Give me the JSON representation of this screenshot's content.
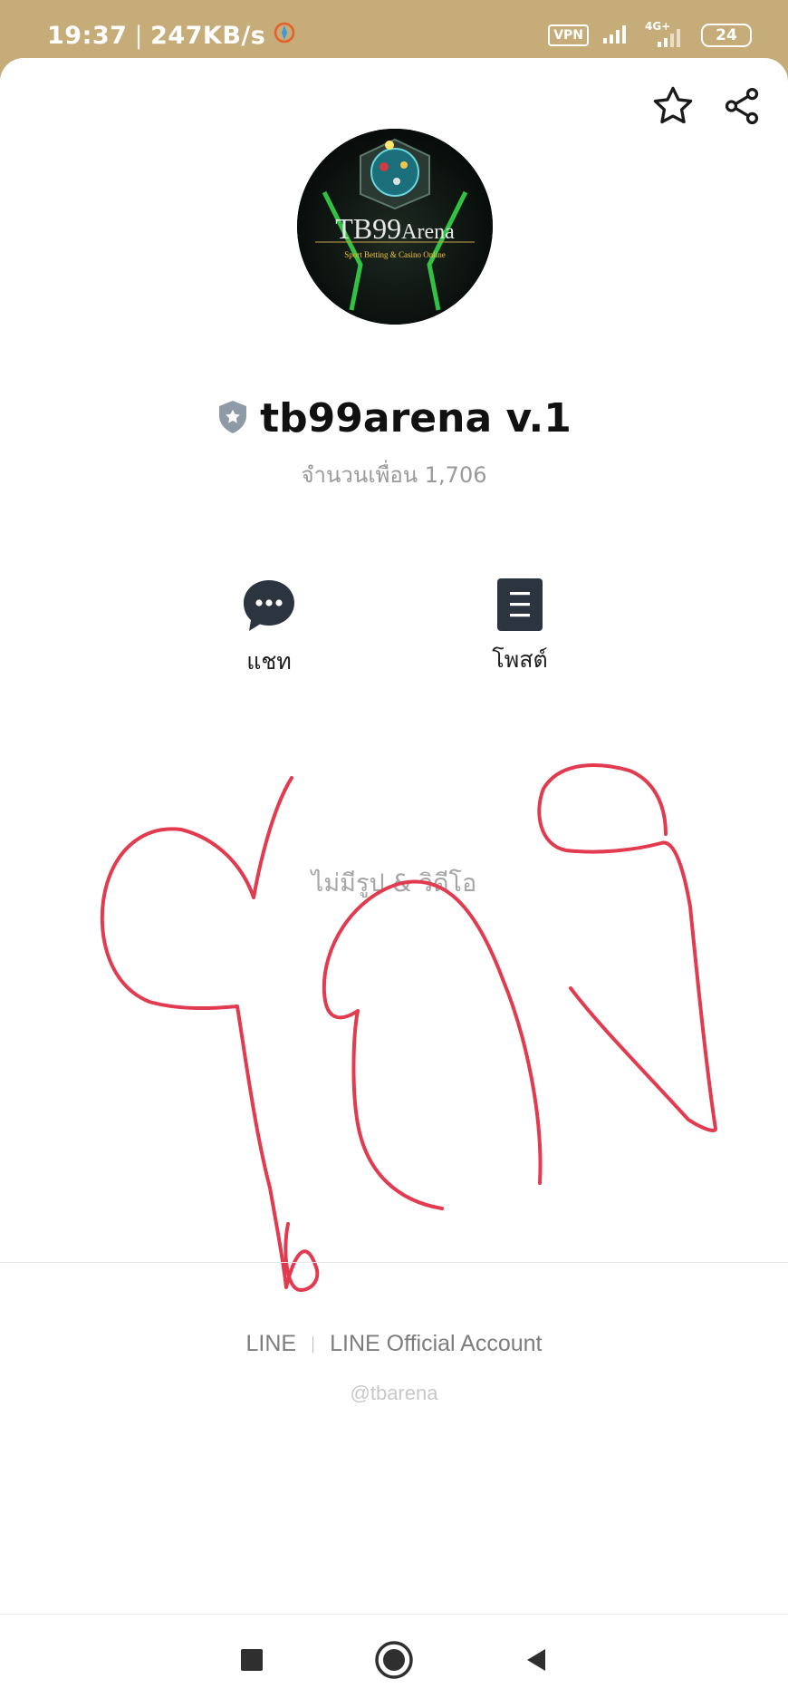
{
  "status_bar": {
    "time": "19:37",
    "separator": "|",
    "speed": "247KB/s",
    "vpn": "VPN",
    "network": "4G+",
    "battery": "24"
  },
  "profile": {
    "name": "tb99arena v.1",
    "friends_label": "จำนวนเพื่อน 1,706",
    "avatar": {
      "brand": "TB99",
      "brand_suffix": "Arena",
      "tagline": "Sport Betting & Casino Online"
    }
  },
  "actions": {
    "chat_label": "แชท",
    "post_label": "โพสต์"
  },
  "content": {
    "empty_text": "ไม่มีรูป & วิดีโอ"
  },
  "footer": {
    "link_line": "LINE",
    "link_official": "LINE Official Account",
    "handle": "@tbarena"
  },
  "icons": {
    "star": "star-icon",
    "share": "share-icon",
    "verified": "shield-badge-icon",
    "chat": "chat-bubble-icon",
    "post": "post-icon"
  },
  "colors": {
    "status_bar": "#c6ac78",
    "scribble": "#e23a4f",
    "avatar_glow": "#38e04b"
  }
}
